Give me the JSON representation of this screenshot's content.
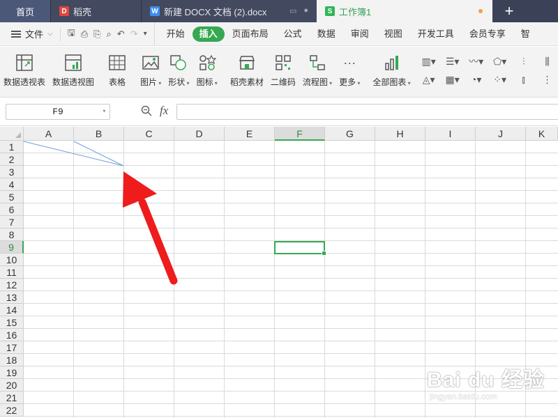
{
  "tabs": {
    "home": "首页",
    "daoke": "稻壳",
    "doc": "新建 DOCX 文档 (2).docx",
    "workbook": "工作簿1",
    "add": "+"
  },
  "menubar": {
    "file": "文件",
    "items": [
      "开始",
      "插入",
      "页面布局",
      "公式",
      "数据",
      "审阅",
      "视图",
      "开发工具",
      "会员专享",
      "智"
    ],
    "active": "插入"
  },
  "ribbon": {
    "pivot_table": "数据透视表",
    "pivot_chart": "数据透视图",
    "table": "表格",
    "picture": "图片",
    "shape": "形状",
    "icon": "图标",
    "daoke_material": "稻壳素材",
    "qrcode": "二维码",
    "flowchart": "流程图",
    "more": "更多",
    "all_charts": "全部图表"
  },
  "formula": {
    "name_box": "F9",
    "fx": "fx",
    "value": ""
  },
  "grid": {
    "columns": [
      "A",
      "B",
      "C",
      "D",
      "E",
      "F",
      "G",
      "H",
      "I",
      "J",
      "K"
    ],
    "rows": [
      "1",
      "2",
      "3",
      "4",
      "5",
      "6",
      "7",
      "8",
      "9",
      "10",
      "11",
      "12",
      "13",
      "14",
      "15",
      "16",
      "17",
      "18",
      "19",
      "20",
      "21",
      "22"
    ],
    "selected_cell": "F9",
    "selected_column": "F",
    "selected_row": "9"
  },
  "colors": {
    "accent": "#36a852",
    "tabbar": "#3b4156",
    "arrow": "#ee1c1c",
    "diagonal_line": "#6f9fd8"
  },
  "watermark": {
    "main": "Bai du 经验",
    "sub": "jingyan.baidu.com"
  }
}
